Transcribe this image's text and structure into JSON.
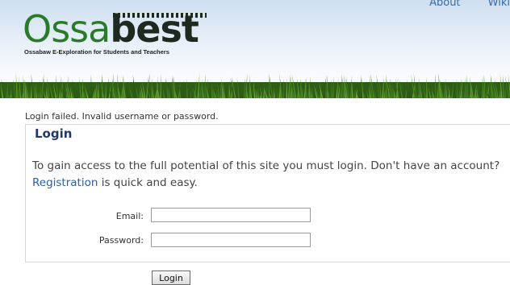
{
  "header": {
    "nav": [
      "About",
      "Wiki"
    ],
    "logo": {
      "word_light": "Ossa",
      "word_dark": "best",
      "tagline": "Ossabaw E-Exploration for Students and Teachers"
    }
  },
  "login": {
    "error_message": "Login failed. Invalid username or password.",
    "legend": "Login",
    "intro_before": "To gain access to the full potential of this site you must login. Don't have an account? ",
    "intro_link": "Registration",
    "intro_after": " is quick and easy.",
    "email_label": "Email:",
    "email_value": "",
    "password_label": "Password:",
    "password_value": "",
    "submit_label": "Login"
  },
  "colors": {
    "brand_green": "#2a7a2a",
    "link_blue": "#2a5ea8",
    "legend_navy": "#1f3a6a"
  }
}
